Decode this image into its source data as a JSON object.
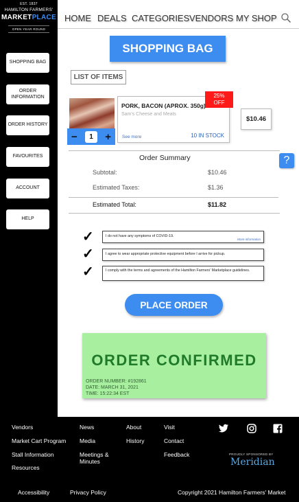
{
  "logo": {
    "est": "EST. 1837",
    "org": "HAMILTON FARMERS'",
    "name_a": "MARKET",
    "name_b": "PLACE",
    "open": "OPEN YEAR ROUND"
  },
  "sidebar": {
    "items": [
      {
        "label": "SHOPPING BAG"
      },
      {
        "label": "ORDER INFORMATION"
      },
      {
        "label": "ORDER HISTORY"
      },
      {
        "label": "FAVOURITES"
      },
      {
        "label": "ACCOUNT"
      },
      {
        "label": "HELP"
      }
    ]
  },
  "nav": {
    "items": [
      "HOME",
      "DEALS",
      "CATEGORIES",
      "VENDORS",
      "MY SHOP"
    ],
    "search_icon": "search-icon"
  },
  "main": {
    "bag_title": "SHOPPING BAG",
    "list_label": "LIST OF ITEMS",
    "item": {
      "name": "PORK, BACON (APROX. 350g)",
      "seller": "Sam's Cheese and Meats",
      "see_more": "See more",
      "stock": "10 IN STOCK",
      "discount_pct": "25%",
      "discount_word": "OFF",
      "price": "$10.46",
      "qty": "1",
      "minus": "−",
      "plus": "+"
    },
    "summary": {
      "title": "Order Summary",
      "subtotal_label": "Subtotal:",
      "subtotal": "$10.46",
      "taxes_label": "Estimated Taxes:",
      "taxes": "$1.36",
      "total_label": "Estimated Total:",
      "total": "$11.82"
    },
    "help": "?",
    "checks": [
      {
        "text": "I do not have any symptoms of COVID-19.",
        "more": "More information"
      },
      {
        "text": "I agree to wear appropriate protective equipment before I arrive for pickup."
      },
      {
        "text": "I comply with the terms and agreements of the Hamilton Farmers' Marketplace guidelines."
      }
    ],
    "checkmark": "✓",
    "place_order": "PLACE ORDER",
    "confirm": {
      "title": "ORDER CONFIRMED",
      "number": "ORDER NUMBER: #192861",
      "date": "DATE: MARCH 31, 2021",
      "time": "TIME: 15:22:34 EST"
    }
  },
  "footer": {
    "col1": [
      "Vendors",
      "Market Cart Program",
      "Stall Information",
      "Resources"
    ],
    "col2": [
      "News",
      "Media",
      "Meetings & Minutes"
    ],
    "col3": [
      "About",
      "History"
    ],
    "col4": [
      "Visit",
      "Contact",
      "Feedback"
    ],
    "bottom": [
      "Accessibility",
      "Privacy Policy"
    ],
    "sponsor": "PROUDLY SPONSORED BY",
    "sponsor_name": "Meridian",
    "copyright": "Copyright 2021 Hamilton Farmers' Market",
    "social": [
      "twitter-icon",
      "instagram-icon",
      "facebook-icon"
    ]
  },
  "colors": {
    "accent": "#3d8cf0",
    "discount": "#ff1a1a",
    "confirm_bg": "#a8f0a0",
    "confirm_text": "#1f7a2a"
  }
}
